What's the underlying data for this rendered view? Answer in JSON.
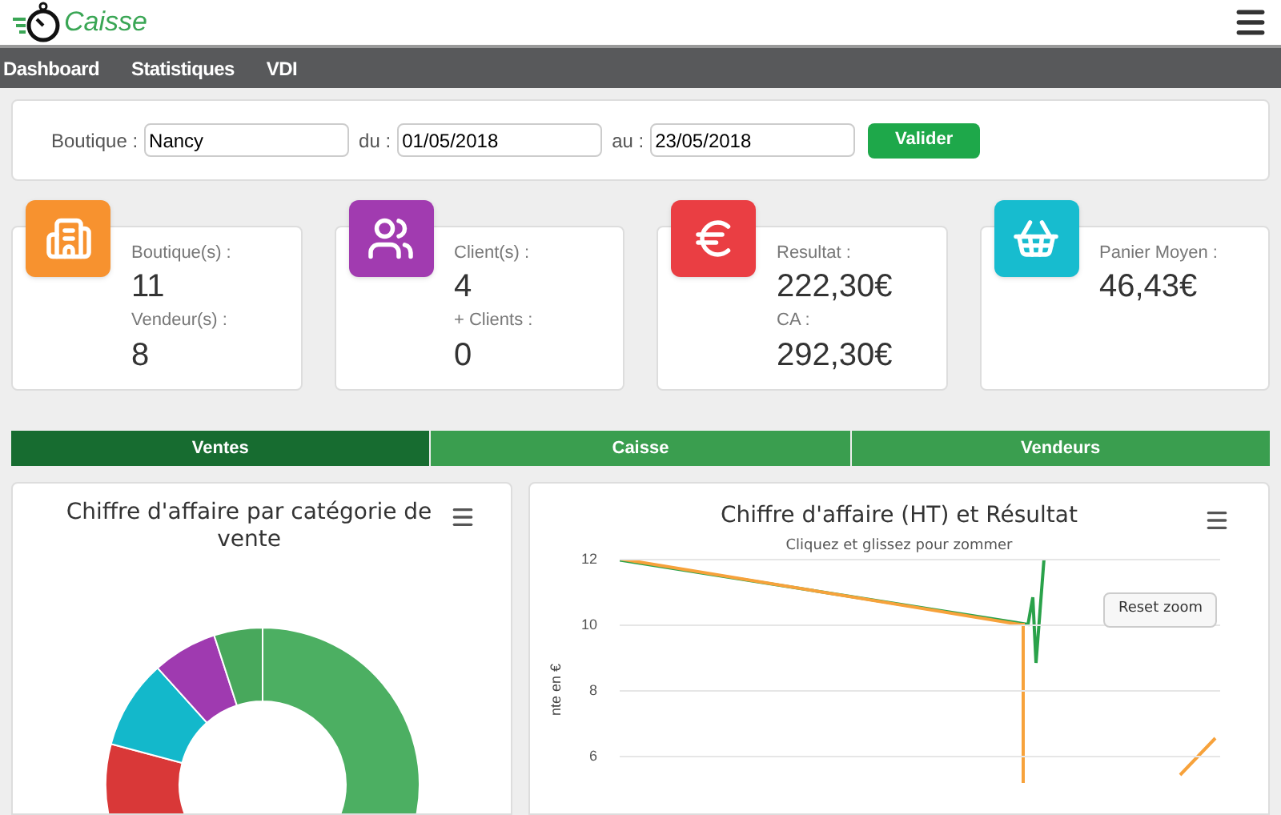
{
  "header": {
    "logo_text": "Caisse"
  },
  "nav": [
    {
      "label": "Dashboard"
    },
    {
      "label": "Statistiques"
    },
    {
      "label": "VDI"
    }
  ],
  "filter": {
    "fields": [
      {
        "label": "Boutique :",
        "value": "Nancy"
      },
      {
        "label": "du :",
        "value": "01/05/2018"
      },
      {
        "label": "au :",
        "value": "23/05/2018"
      }
    ],
    "button": "Valider"
  },
  "stats": [
    {
      "kind": "building",
      "color": "#f7922f",
      "rows": [
        {
          "label": "Boutique(s) :",
          "value": "11"
        },
        {
          "label": "Vendeur(s) :",
          "value": "8"
        }
      ]
    },
    {
      "kind": "users",
      "color": "#a13bb0",
      "rows": [
        {
          "label": "Client(s) :",
          "value": "4"
        },
        {
          "label": "+ Clients :",
          "value": "0"
        }
      ]
    },
    {
      "kind": "euro",
      "color": "#ea3e43",
      "rows": [
        {
          "label": "Resultat :",
          "value": "222,30€"
        },
        {
          "label": "CA :",
          "value": "292,30€"
        }
      ]
    },
    {
      "kind": "basket",
      "color": "#17bccf",
      "rows": [
        {
          "label": "Panier Moyen :",
          "value": "46,43€"
        }
      ]
    }
  ],
  "tabs": [
    {
      "label": "Ventes",
      "selected": true
    },
    {
      "label": "Caisse",
      "selected": false
    },
    {
      "label": "Vendeurs",
      "selected": false
    }
  ],
  "donut_panel": {
    "title": "Chiffre d'affaire par catégorie de vente"
  },
  "line_panel": {
    "title": "Chiffre d'affaire (HT) et Résultat",
    "subtitle": "Cliquez et glissez pour zommer",
    "reset_button": "Reset zoom",
    "y_ticks": [
      "12",
      "10",
      "8",
      "6"
    ],
    "y_label": "nte en €"
  }
}
